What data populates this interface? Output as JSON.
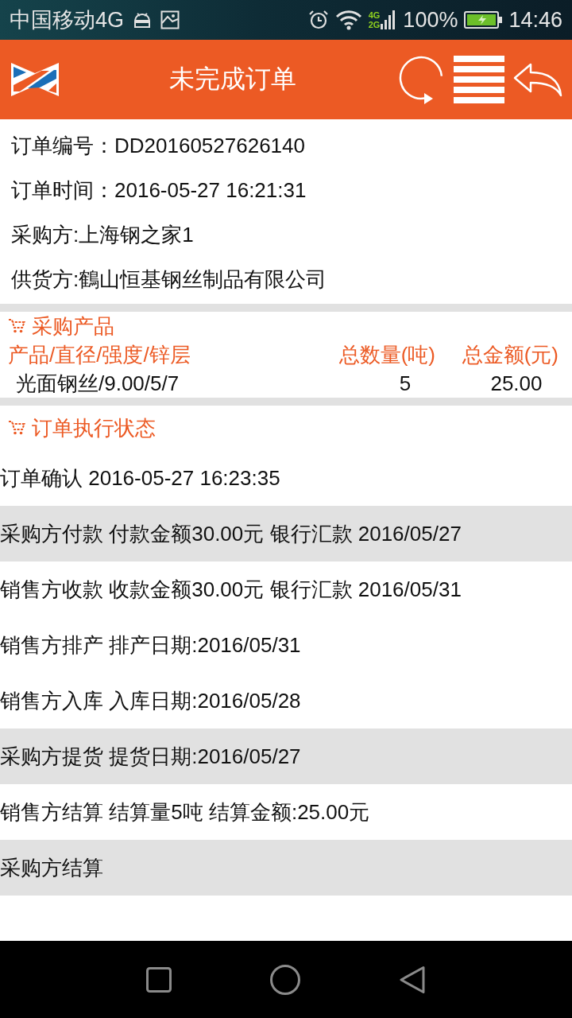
{
  "status_bar": {
    "carrier": "中国移动4G",
    "network_types": [
      "4G",
      "2G"
    ],
    "battery": "100%",
    "time": "14:46"
  },
  "header": {
    "title": "未完成订单"
  },
  "order_info": [
    {
      "label": "订单编号：",
      "value": "DD20160527626140"
    },
    {
      "label": "订单时间：",
      "value": "2016-05-27 16:21:31"
    },
    {
      "label": "采购方:",
      "value": "上海钢之家1"
    },
    {
      "label": "供货方:",
      "value": "鶴山恒基钢丝制品有限公司"
    }
  ],
  "products": {
    "title": "采购产品",
    "columns": [
      "产品/直径/强度/锌层",
      "总数量(吨)",
      "总金额(元)"
    ],
    "rows": [
      [
        "光面钢丝/9.00/5/7",
        "5",
        "25.00"
      ]
    ]
  },
  "execution": {
    "title": "订单执行状态",
    "steps": [
      {
        "text": "订单确认 2016-05-27 16:23:35",
        "highlighted": false
      },
      {
        "text": "采购方付款 付款金额30.00元 银行汇款 2016/05/27",
        "highlighted": true
      },
      {
        "text": "销售方收款 收款金额30.00元 银行汇款 2016/05/31",
        "highlighted": false
      },
      {
        "text": "销售方排产 排产日期:2016/05/31",
        "highlighted": false
      },
      {
        "text": "销售方入库 入库日期:2016/05/28",
        "highlighted": false
      },
      {
        "text": "采购方提货 提货日期:2016/05/27",
        "highlighted": true
      },
      {
        "text": "销售方结算 结算量5吨 结算金额:25.00元",
        "highlighted": false
      },
      {
        "text": "采购方结算",
        "highlighted": true
      }
    ]
  }
}
